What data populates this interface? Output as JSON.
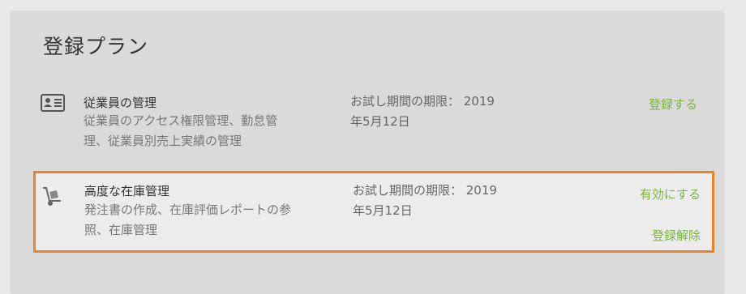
{
  "page": {
    "title": "登録プラン"
  },
  "plans": [
    {
      "icon": "id-card-icon",
      "title": "従業員の管理",
      "desc_line1": "従業員のアクセス権限管理、勤怠管",
      "desc_line2": "理、従業員別売上実績の管理",
      "trial_line1": "お試し期間の期限： 2019",
      "trial_line2": "年5月12日",
      "action": "登録する"
    },
    {
      "icon": "hand-truck-icon",
      "title": "高度な在庫管理",
      "desc_line1": "発注書の作成、在庫評価レポートの参",
      "desc_line2": "照、在庫管理",
      "trial_line1": "お試し期間の期限： 2019",
      "trial_line2": "年5月12日",
      "action_enable": "有効にする",
      "action_unsubscribe": "登録解除"
    }
  ],
  "colors": {
    "accent": "#7cb342",
    "highlight": "#e8862c"
  }
}
